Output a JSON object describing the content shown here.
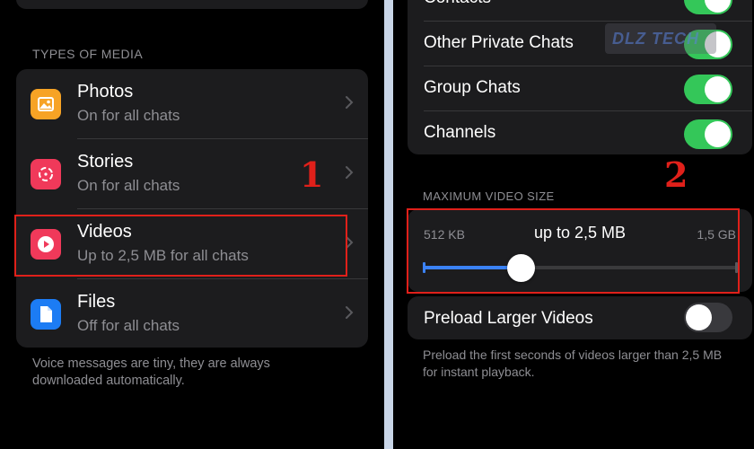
{
  "left": {
    "section_header": "TYPES OF MEDIA",
    "items": [
      {
        "title": "Photos",
        "subtitle": "On for all chats",
        "icon": "photo-icon",
        "color": "#f7a325"
      },
      {
        "title": "Stories",
        "subtitle": "On for all chats",
        "icon": "stories-icon",
        "color": "#f0395a"
      },
      {
        "title": "Videos",
        "subtitle": "Up to 2,5 MB for all chats",
        "icon": "play-icon",
        "color": "#f0395a"
      },
      {
        "title": "Files",
        "subtitle": "Off for all chats",
        "icon": "file-icon",
        "color": "#1c7cf4"
      }
    ],
    "footer": "Voice messages are tiny, they are always downloaded automatically.",
    "step_number": "1"
  },
  "right": {
    "toggles": [
      {
        "label": "Contacts",
        "on": true
      },
      {
        "label": "Other Private Chats",
        "on": true
      },
      {
        "label": "Group Chats",
        "on": true
      },
      {
        "label": "Channels",
        "on": true
      }
    ],
    "video_size_header": "MAXIMUM VIDEO SIZE",
    "slider": {
      "min_label": "512 KB",
      "value_label": "up to 2,5 MB",
      "max_label": "1,5 GB",
      "fraction": 0.31
    },
    "preload": {
      "label": "Preload Larger Videos",
      "on": false
    },
    "footer": "Preload the first seconds of videos larger than 2,5 MB for instant playback.",
    "step_number": "2",
    "watermark": "DLZ TECH"
  },
  "colors": {
    "accent_blue": "#3b82f6",
    "toggle_on": "#34c759",
    "highlight_red": "#e0201a"
  }
}
